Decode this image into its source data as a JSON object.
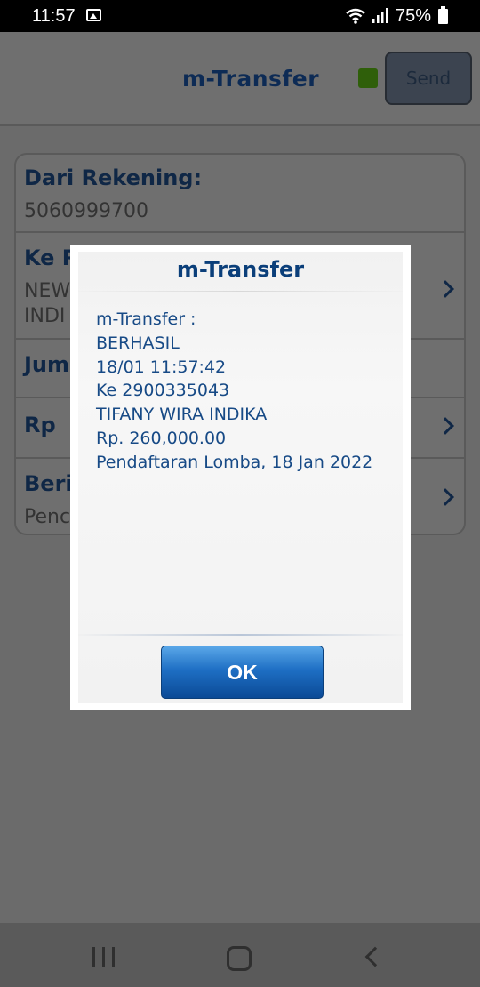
{
  "status_bar": {
    "time": "11:57",
    "battery": "75%",
    "icons": [
      "image-icon",
      "wifi-icon",
      "signal-icon",
      "battery-icon"
    ]
  },
  "header": {
    "title": "m-Transfer",
    "send_label": "Send",
    "status_color": "#2f5f0a"
  },
  "form": {
    "dari_label": "Dari Rekening:",
    "dari_value": "5060999700",
    "ke_label": "Ke R",
    "ke_line1": "NEW",
    "ke_line2": "INDI",
    "jumlah_label": "Juml",
    "rp_label": "Rp",
    "berita_label": "Beri",
    "berita_value": "Penc"
  },
  "dialog": {
    "title": "m-Transfer",
    "lines": [
      "m-Transfer :",
      "BERHASIL",
      "18/01 11:57:42",
      "Ke 2900335043",
      "TIFANY WIRA INDIKA",
      "Rp. 260,000.00",
      "Pendaftaran Lomba, 18 Jan 2022"
    ],
    "ok_label": "OK"
  },
  "colors": {
    "accent": "#0b3f7a",
    "message_text": "#174a86",
    "overlay": "#6b6b6b"
  }
}
